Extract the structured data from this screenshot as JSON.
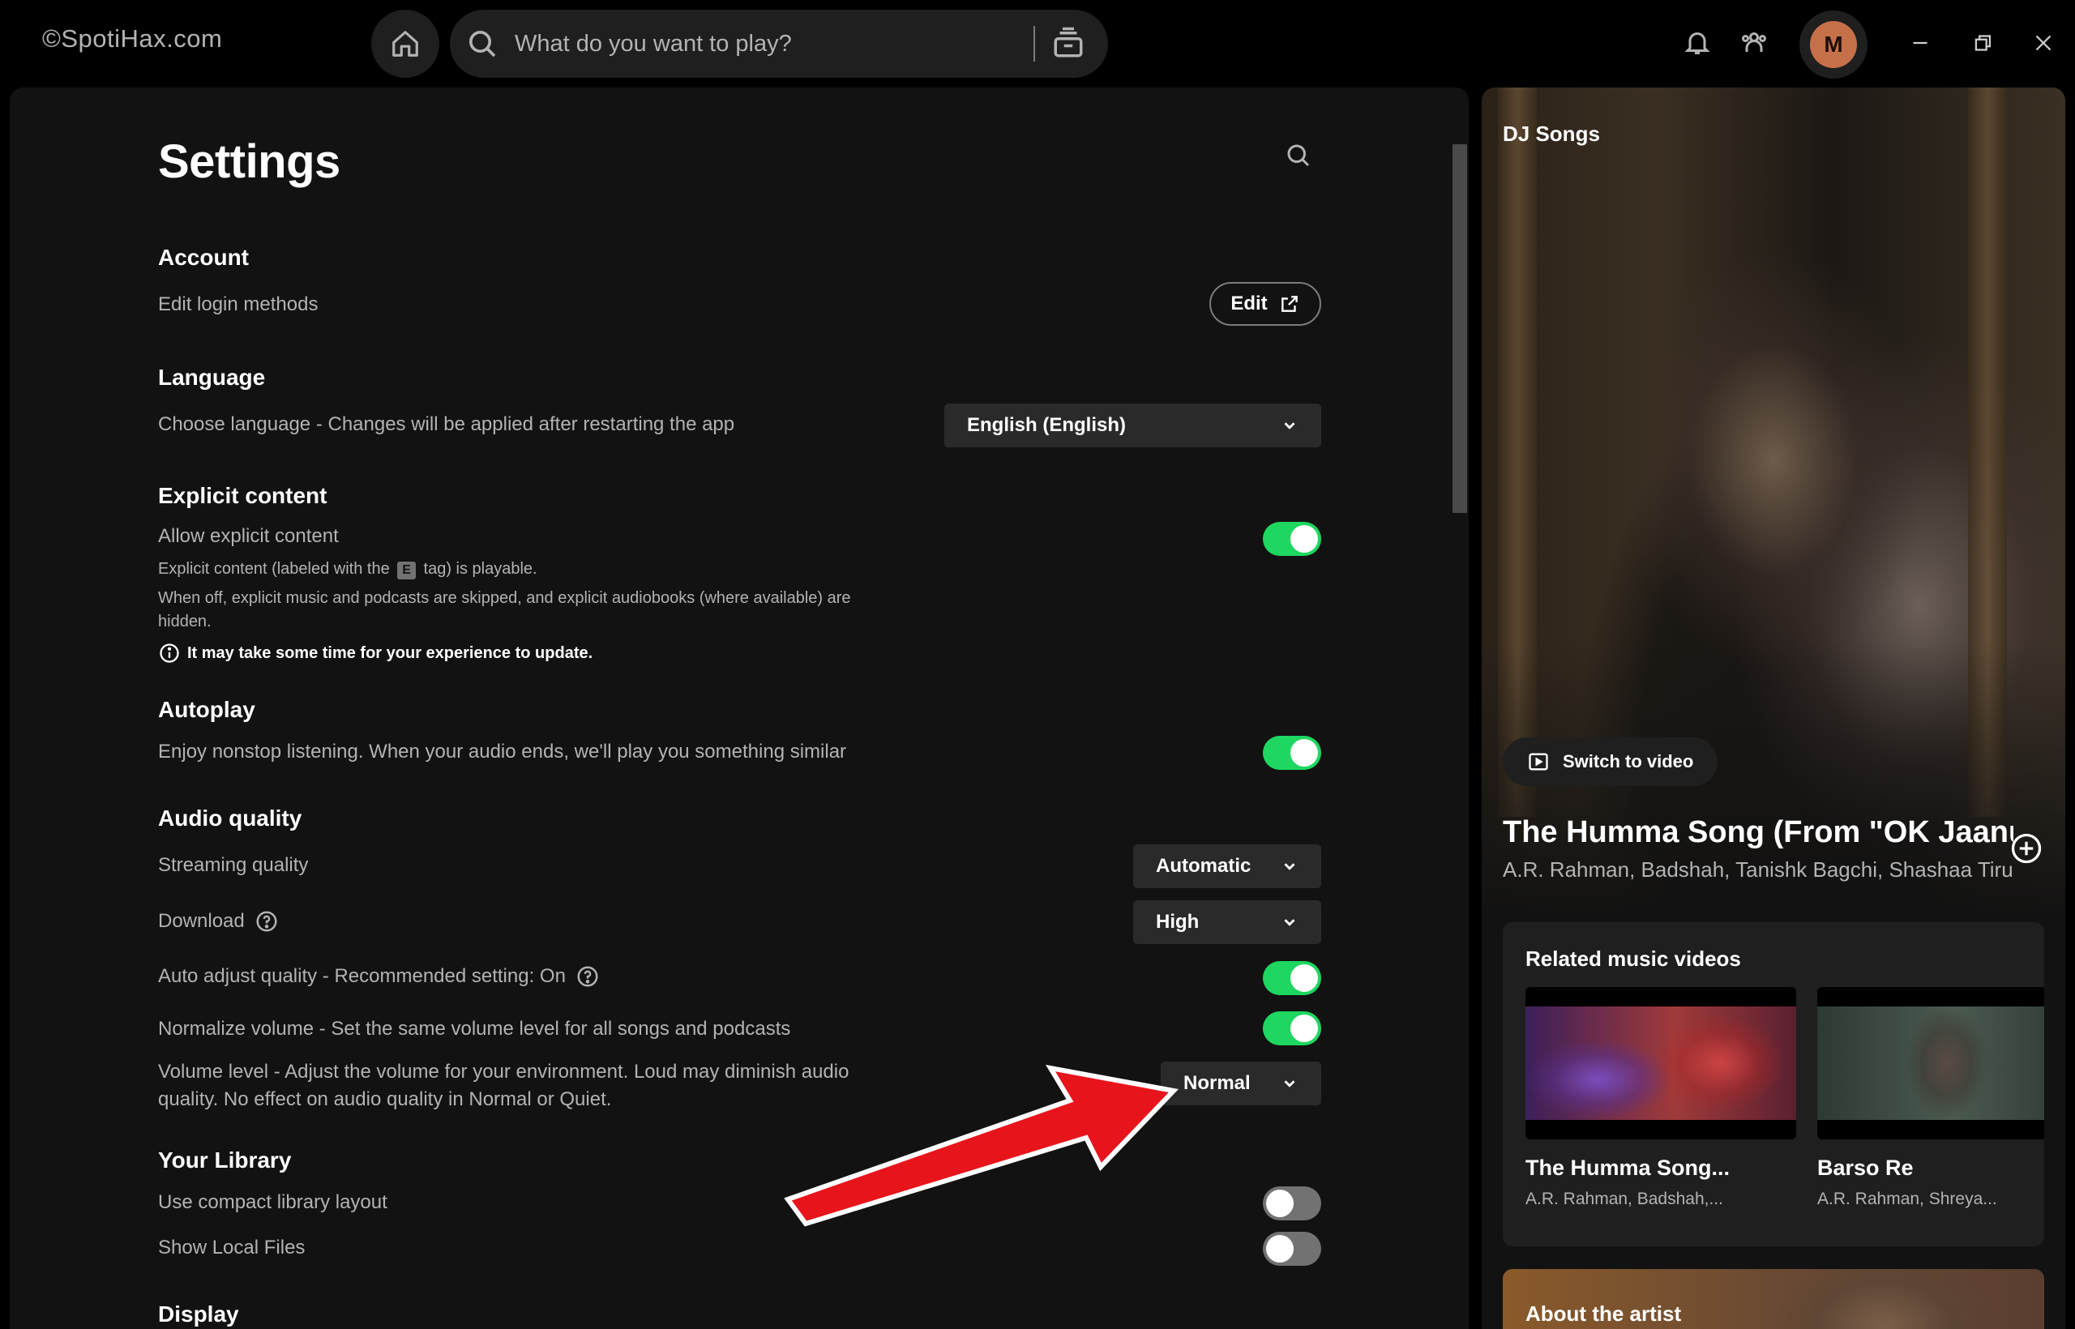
{
  "topbar": {
    "watermark": "©SpotiHax.com",
    "search_placeholder": "What do you want to play?",
    "avatar_initial": "M"
  },
  "settings": {
    "title": "Settings",
    "account": {
      "heading": "Account",
      "edit_login": "Edit login methods",
      "edit_label": "Edit"
    },
    "language": {
      "heading": "Language",
      "description": "Choose language - Changes will be applied after restarting the app",
      "selected": "English (English)"
    },
    "explicit": {
      "heading": "Explicit content",
      "allow_label": "Allow explicit content",
      "line1_before": "Explicit content (labeled with the",
      "tag": "E",
      "line1_after": "tag) is playable.",
      "line2": "When off, explicit music and podcasts are skipped, and explicit audiobooks (where available) are hidden.",
      "info": "It may take some time for your experience to update.",
      "enabled": true
    },
    "autoplay": {
      "heading": "Autoplay",
      "description": "Enjoy nonstop listening. When your audio ends, we'll play you something similar",
      "enabled": true
    },
    "audio_quality": {
      "heading": "Audio quality",
      "streaming_label": "Streaming quality",
      "streaming_value": "Automatic",
      "download_label": "Download",
      "download_value": "High",
      "auto_adjust_label": "Auto adjust quality - Recommended setting: On",
      "auto_adjust_enabled": true,
      "normalize_label": "Normalize volume - Set the same volume level for all songs and podcasts",
      "normalize_enabled": true,
      "volume_label": "Volume level - Adjust the volume for your environment. Loud may diminish audio quality. No effect on audio quality in Normal or Quiet.",
      "volume_value": "Normal"
    },
    "library": {
      "heading": "Your Library",
      "compact_label": "Use compact library layout",
      "compact_enabled": false,
      "local_files_label": "Show Local Files",
      "local_files_enabled": false
    },
    "display": {
      "heading": "Display"
    }
  },
  "now_playing": {
    "playlist": "DJ Songs",
    "switch_video": "Switch to video",
    "title": "The Humma Song (From \"OK Jaanu\")",
    "artists": "A.R. Rahman, Badshah, Tanishk Bagchi, Shashaa Tirupati",
    "related_heading": "Related music videos",
    "related": [
      {
        "title": "The Humma Song...",
        "artists": "A.R. Rahman, Badshah,..."
      },
      {
        "title": "Barso Re",
        "artists": "A.R. Rahman, Shreya..."
      }
    ],
    "about_heading": "About the artist"
  },
  "colors": {
    "accent": "#1ed760",
    "background": "#121212",
    "annotation_arrow": "#e8141c"
  }
}
